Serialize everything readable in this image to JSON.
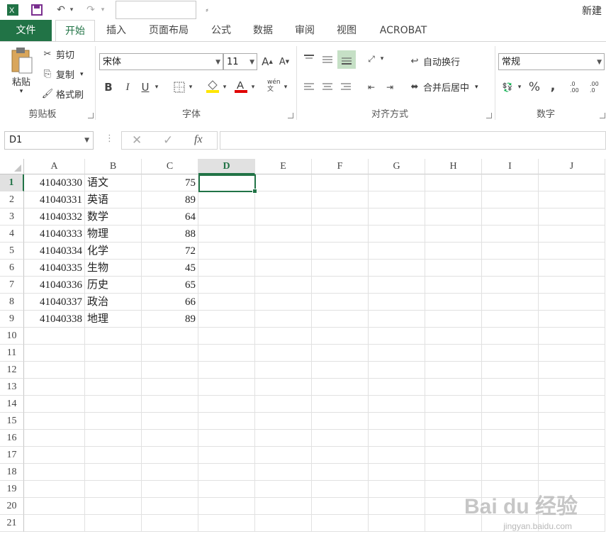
{
  "title": {
    "app_name": "新建"
  },
  "qat": {
    "excel_icon": "excel-icon",
    "save_icon": "save-icon",
    "undo_icon": "undo-icon",
    "redo_icon": "redo-icon",
    "search_value": "",
    "customize": "⌄"
  },
  "tabs": [
    {
      "label": "文件"
    },
    {
      "label": "开始"
    },
    {
      "label": "插入"
    },
    {
      "label": "页面布局"
    },
    {
      "label": "公式"
    },
    {
      "label": "数据"
    },
    {
      "label": "审阅"
    },
    {
      "label": "视图"
    },
    {
      "label": "ACROBAT"
    }
  ],
  "ribbon": {
    "clipboard": {
      "paste": "粘贴",
      "cut": "剪切",
      "copy": "复制",
      "format_painter": "格式刷",
      "label": "剪贴板"
    },
    "font": {
      "font_name": "宋体",
      "font_size": "11",
      "bold": "B",
      "italic": "I",
      "underline": "U",
      "label": "字体",
      "grow": "A",
      "shrink": "A",
      "phonetic": "wén 文"
    },
    "alignment": {
      "wrap_text": "自动换行",
      "merge_center": "合并后居中",
      "label": "对齐方式"
    },
    "number": {
      "format": "常规",
      "percent": "%",
      "comma": ",",
      "label": "数字",
      "inc_decimal": ".0 .00",
      "dec_decimal": ".00 .0"
    }
  },
  "formula_bar": {
    "name_box": "D1",
    "cancel": "✕",
    "enter": "✓",
    "fx": "fx",
    "formula": ""
  },
  "grid": {
    "columns": [
      "A",
      "B",
      "C",
      "D",
      "E",
      "F",
      "G",
      "H",
      "I",
      "J"
    ],
    "active_column": "D",
    "active_row": 1,
    "rows": [
      "1",
      "2",
      "3",
      "4",
      "5",
      "6",
      "7",
      "8",
      "9",
      "10",
      "11",
      "12",
      "13",
      "14",
      "15",
      "16",
      "17",
      "18",
      "19",
      "20",
      "21"
    ],
    "data": [
      {
        "a": "41040330",
        "b": "语文",
        "c": "75"
      },
      {
        "a": "41040331",
        "b": "英语",
        "c": "89"
      },
      {
        "a": "41040332",
        "b": "数学",
        "c": "64"
      },
      {
        "a": "41040333",
        "b": "物理",
        "c": "88"
      },
      {
        "a": "41040334",
        "b": "化学",
        "c": "72"
      },
      {
        "a": "41040335",
        "b": "生物",
        "c": "45"
      },
      {
        "a": "41040336",
        "b": "历史",
        "c": "65"
      },
      {
        "a": "41040337",
        "b": "政治",
        "c": "66"
      },
      {
        "a": "41040338",
        "b": "地理",
        "c": "89"
      }
    ]
  },
  "watermark": {
    "text": "Bai du 经验",
    "sub": "jingyan.baidu.com"
  },
  "colors": {
    "accent": "#217346",
    "grid_line": "#e1e1e1",
    "header_active": "#e1e1e1"
  }
}
